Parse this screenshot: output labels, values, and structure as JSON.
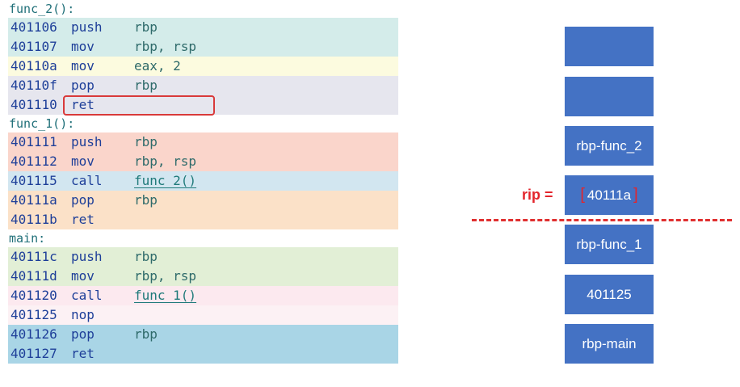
{
  "code": {
    "sections": [
      {
        "label": "func_2():",
        "rows": [
          {
            "addr": "401106",
            "mnem": "push",
            "ops": "rbp",
            "color": "#d4ecea"
          },
          {
            "addr": "401107",
            "mnem": "mov",
            "ops": "rbp, rsp",
            "color": "#d4ecea"
          },
          {
            "addr": "40110a",
            "mnem": "mov",
            "ops": "eax, 2",
            "color": "#fcfbdf"
          },
          {
            "addr": "40110f",
            "mnem": "pop",
            "ops": "rbp",
            "color": "#e6e6ee"
          },
          {
            "addr": "401110",
            "mnem": "ret",
            "ops": "",
            "color": "#e6e6ee",
            "highlight": true
          }
        ]
      },
      {
        "label": "func_1():",
        "rows": [
          {
            "addr": "401111",
            "mnem": "push",
            "ops": "rbp",
            "color": "#fad5cb"
          },
          {
            "addr": "401112",
            "mnem": "mov",
            "ops": "rbp, rsp",
            "color": "#fad5cb"
          },
          {
            "addr": "401115",
            "mnem": "call",
            "ops": "func_2()",
            "color": "#d2e6f0",
            "link": true
          },
          {
            "addr": "40111a",
            "mnem": "pop",
            "ops": "rbp",
            "color": "#fbe1c8"
          },
          {
            "addr": "40111b",
            "mnem": "ret",
            "ops": "",
            "color": "#fbe1c8"
          }
        ]
      },
      {
        "label": "main:",
        "rows": [
          {
            "addr": "40111c",
            "mnem": "push",
            "ops": "rbp",
            "color": "#e2efd6"
          },
          {
            "addr": "40111d",
            "mnem": "mov",
            "ops": "rbp, rsp",
            "color": "#e2efd6"
          },
          {
            "addr": "401120",
            "mnem": "call",
            "ops": "func_1()",
            "color": "#fce9ef",
            "link": true
          },
          {
            "addr": "401125",
            "mnem": "nop",
            "ops": "",
            "color": "#fcf1f4"
          },
          {
            "addr": "401126",
            "mnem": "pop",
            "ops": "rbp",
            "color": "#a9d5e6"
          },
          {
            "addr": "401127",
            "mnem": "ret",
            "ops": "",
            "color": "#a9d5e6"
          }
        ]
      }
    ]
  },
  "stack": {
    "cells": [
      "",
      "",
      "rbp-func_2",
      "40111a",
      "rbp-func_1",
      "401125",
      "rbp-main"
    ],
    "rip_label": "rip =",
    "rip_value": "40111a",
    "bracket_open": "[",
    "bracket_close": "]",
    "cell_color": "#4472c4",
    "accent_color": "#e3242b"
  }
}
